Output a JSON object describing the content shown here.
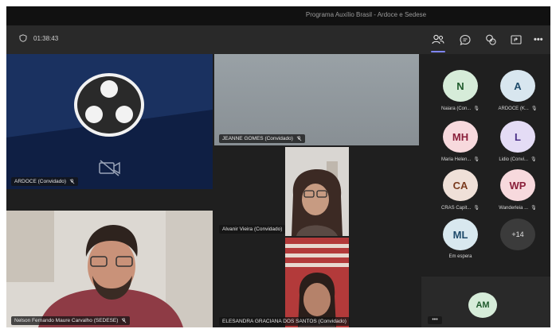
{
  "window": {
    "title": "Programa Auxílio Brasil - Ardoce e Sedese"
  },
  "toolbar": {
    "timer": "01:38:43",
    "icons": [
      "shield-icon",
      "people-icon",
      "chat-icon",
      "reactions-icon",
      "share-icon",
      "more-icon"
    ],
    "more_label": "•••"
  },
  "tiles": {
    "ardoce": {
      "name": "ARDOCE (Convidado)"
    },
    "jeanne": {
      "name": "JEANNE GOMES (Convidado)"
    },
    "alvanir": {
      "name": "Alvanir Vieira (Convidado)"
    },
    "nelson": {
      "name": "Nelson Fernando Maure Carvalho (SEDESE)"
    },
    "elesandra": {
      "name": "ELESANDRA GRACIANA DOS SANTOS (Convidado)"
    }
  },
  "participants": [
    {
      "initials": "N",
      "name": "Naiara (Con...",
      "bg": "#d6ecd9",
      "fg": "#1f5a2c"
    },
    {
      "initials": "A",
      "name": "ARDOCE (K...",
      "bg": "#d8e6ef",
      "fg": "#1e4a6a"
    },
    {
      "initials": "MH",
      "name": "Maria Helen...",
      "bg": "#f7d9dd",
      "fg": "#8a1f3a"
    },
    {
      "initials": "L",
      "name": "Lidio (Convi...",
      "bg": "#e4dcf5",
      "fg": "#4a2f86"
    },
    {
      "initials": "CA",
      "name": "CRAS Capit...",
      "bg": "#efe0d8",
      "fg": "#7a3a1e"
    },
    {
      "initials": "WP",
      "name": "Wanderleia ...",
      "bg": "#f7d9dd",
      "fg": "#8a1f3a"
    },
    {
      "initials": "ML",
      "name": "Em espera",
      "bg": "#d8e8ef",
      "fg": "#1e4a6a"
    },
    {
      "initials": "+14",
      "name": "",
      "bg": "#3b3b3b",
      "fg": "#e0e0e0"
    }
  ],
  "self_view": {
    "initials": "AM",
    "bg": "#d6ecd9",
    "fg": "#1f5a2c",
    "more": "•••"
  }
}
